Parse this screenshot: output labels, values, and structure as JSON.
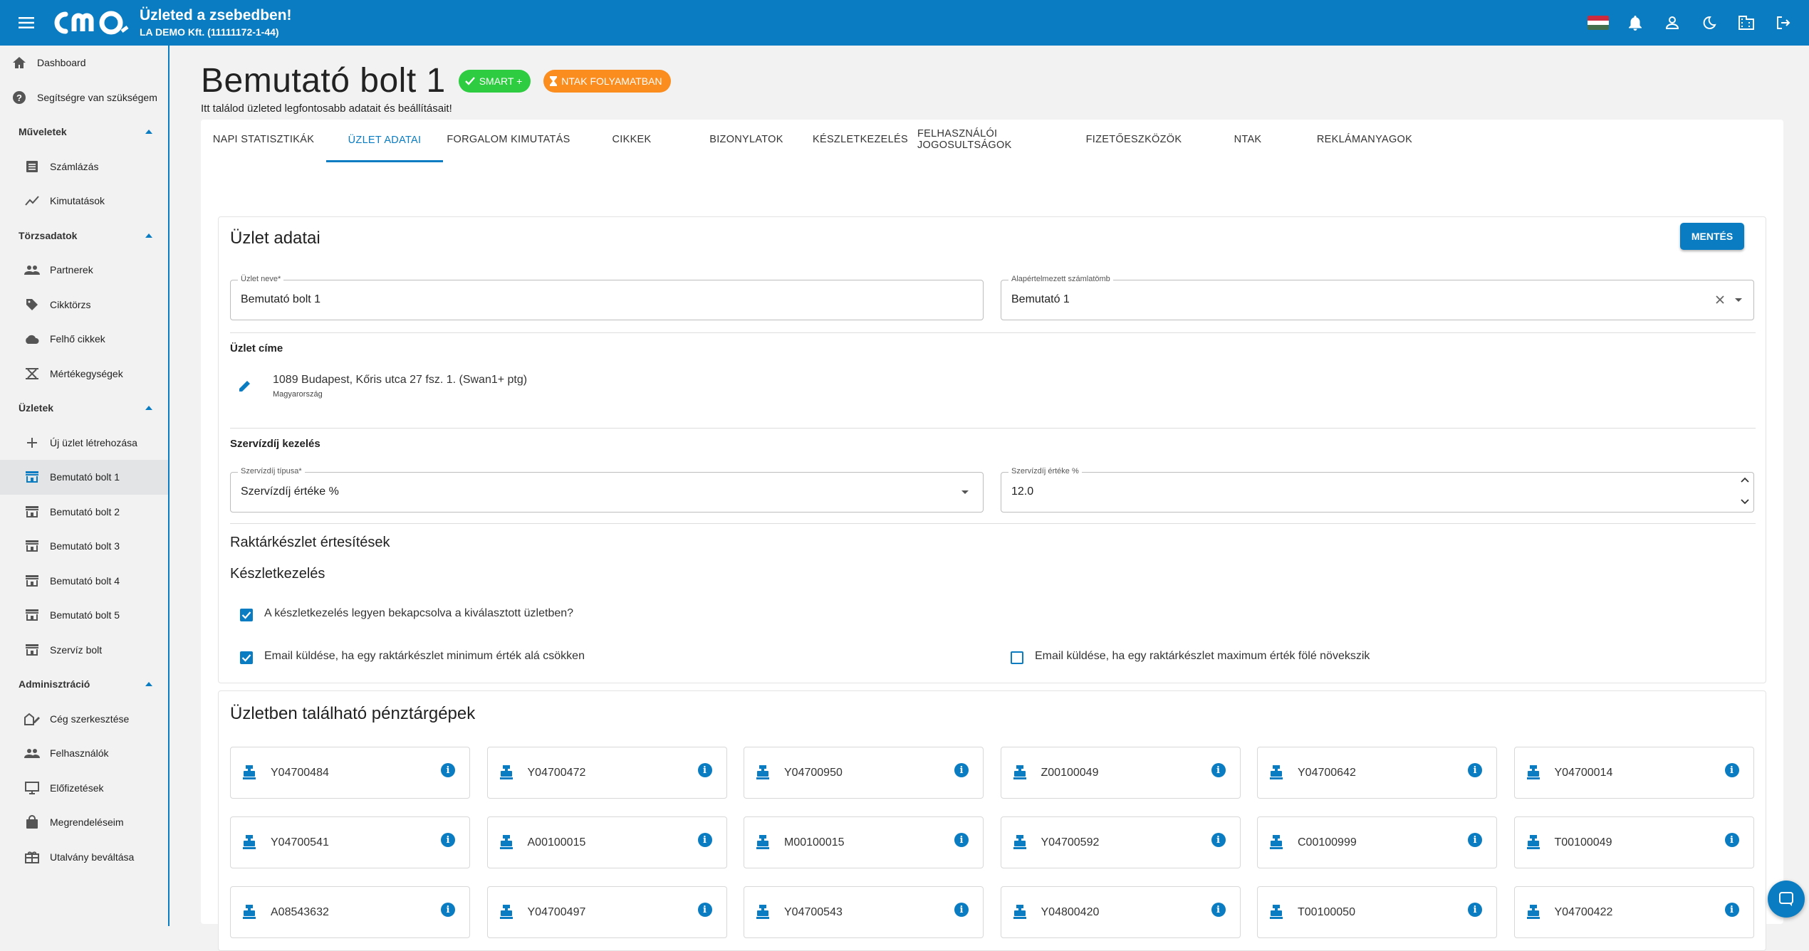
{
  "header": {
    "tagline": "Üzleted a zsebedben!",
    "company": "LA DEMO Kft. (11111172-1-44)",
    "colors": {
      "primary": "#0a7cc1",
      "green": "#2ecc40",
      "orange": "#fb8c1e"
    },
    "actions": [
      "hu-flag-icon",
      "bell-icon",
      "account-icon",
      "dark-mode-icon",
      "business-icon",
      "logout-icon"
    ]
  },
  "sidebar": {
    "dashboard": "Dashboard",
    "help": "Segítségre van szükségem",
    "sec_ops": "Műveletek",
    "invoicing": "Számlázás",
    "reports": "Kimutatások",
    "sec_master": "Törzsadatok",
    "partners": "Partnerek",
    "items": "Cikktörzs",
    "cloud_items": "Felhő cikkek",
    "units": "Mértékegységek",
    "sec_stores": "Üzletek",
    "new_store": "Új üzlet létrehozása",
    "store1": "Bemutató bolt 1",
    "store2": "Bemutató bolt 2",
    "store3": "Bemutató bolt 3",
    "store4": "Bemutató bolt 4",
    "store5": "Bemutató bolt 5",
    "service_store": "Szervíz bolt",
    "sec_admin": "Adminisztráció",
    "company_edit": "Cég szerkesztése",
    "users": "Felhasználók",
    "subscriptions": "Előfizetések",
    "orders": "Megrendeléseim",
    "voucher": "Utalvány beváltása"
  },
  "page": {
    "title": "Bemutató bolt 1",
    "chip_smart": "SMART +",
    "chip_ntak": "NTAK FOLYAMATBAN",
    "subtitle": "Itt találod üzleted legfontosabb adatait és beállításait!"
  },
  "tabs": {
    "t1": "NAPI STATISZTIKÁK",
    "t2": "ÜZLET ADATAI",
    "t3": "FORGALOM KIMUTATÁS",
    "t4": "CIKKEK",
    "t5": "BIZONYLATOK",
    "t6": "KÉSZLETKEZELÉS",
    "t7": "FELHASZNÁLÓI JOGOSULTSÁGOK",
    "t8": "FIZETŐESZKÖZÖK",
    "t9": "NTAK",
    "t10": "REKLÁMANYAGOK"
  },
  "store": {
    "panel_title": "Üzlet adatai",
    "save": "MENTÉS",
    "name_label": "Üzlet neve*",
    "name_value": "Bemutató bolt 1",
    "invoice_label": "Alapértelmezett számlatömb",
    "invoice_value": "Bemutató 1",
    "address_head": "Üzlet címe",
    "address": "1089 Budapest, Kőris utca 27 fsz. 1. (Swan1+ ptg)",
    "country": "Magyarország",
    "service_head": "Szervízdíj kezelés",
    "service_type_label": "Szervízdíj típusa*",
    "service_type_value": "Szervízdíj értéke %",
    "service_value_label": "Szervízdíj értéke %",
    "service_value": "12.0",
    "stock_notify": "Raktárkészlet értesítések",
    "stock_mgmt": "Készletkezelés",
    "cb1": "A készletkezelés legyen bekapcsolva a kiválasztott üzletben?",
    "cb1_checked": true,
    "cb2": "Email küldése, ha egy raktárkészlet minimum érték alá csökken",
    "cb2_checked": true,
    "cb3": "Email küldése, ha egy raktárkészlet maximum érték fölé növekszik",
    "cb3_checked": false
  },
  "tills": {
    "title": "Üzletben található pénztárgépek",
    "codes": [
      "Y04700484",
      "Y04700472",
      "Y04700950",
      "Z00100049",
      "Y04700642",
      "Y04700014",
      "Y04700541",
      "A00100015",
      "M00100015",
      "Y04700592",
      "C00100999",
      "T00100049",
      "A08543632",
      "Y04700497",
      "Y04700543",
      "Y04800420",
      "T00100050",
      "Y04700422"
    ]
  }
}
